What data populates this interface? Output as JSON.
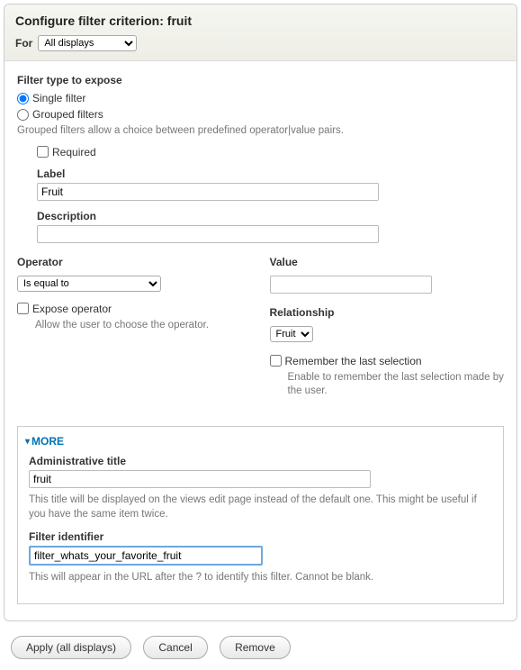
{
  "header": {
    "title": "Configure filter criterion: fruit",
    "for_label": "For",
    "for_value": "All displays"
  },
  "filter_type": {
    "heading": "Filter type to expose",
    "single": "Single filter",
    "grouped": "Grouped filters",
    "grouped_help": "Grouped filters allow a choice between predefined operator|value pairs."
  },
  "required": {
    "label": "Required"
  },
  "label_field": {
    "label": "Label",
    "value": "Fruit"
  },
  "description_field": {
    "label": "Description",
    "value": ""
  },
  "operator": {
    "label": "Operator",
    "value": "Is equal to",
    "expose_label": "Expose operator",
    "expose_help": "Allow the user to choose the operator."
  },
  "value": {
    "label": "Value",
    "value": ""
  },
  "relationship": {
    "label": "Relationship",
    "value": "Fruit"
  },
  "remember": {
    "label": "Remember the last selection",
    "help": "Enable to remember the last selection made by the user."
  },
  "more": {
    "toggle": "MORE",
    "admin_title_label": "Administrative title",
    "admin_title_value": "fruit",
    "admin_title_help": "This title will be displayed on the views edit page instead of the default one. This might be useful if you have the same item twice.",
    "filter_id_label": "Filter identifier",
    "filter_id_value": "filter_whats_your_favorite_fruit",
    "filter_id_help": "This will appear in the URL after the ? to identify this filter. Cannot be blank."
  },
  "buttons": {
    "apply": "Apply (all displays)",
    "cancel": "Cancel",
    "remove": "Remove"
  }
}
